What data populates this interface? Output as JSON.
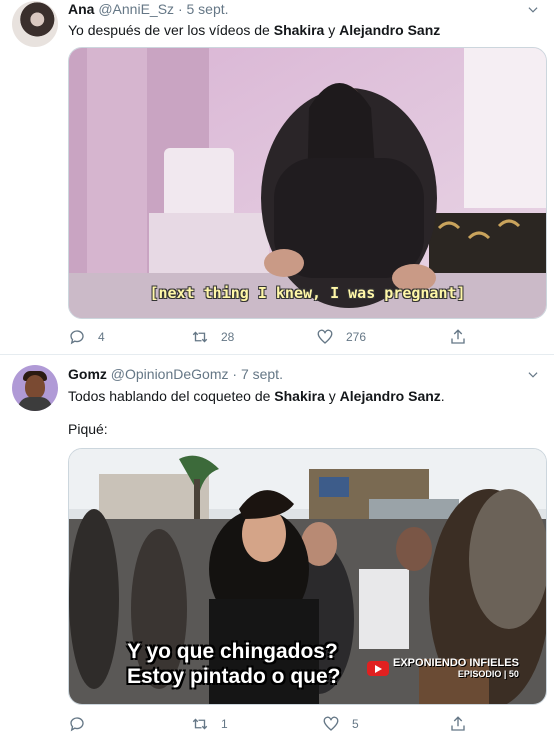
{
  "tweets": [
    {
      "name": "Ana",
      "handle": "@AnniE_Sz",
      "sep": "·",
      "date": "5 sept.",
      "text": {
        "p1": "Yo después de ver los vídeos de ",
        "b1": "Shakira",
        "p2": " y ",
        "b2": "Alejandro Sanz"
      },
      "media": {
        "caption": "[next thing I knew, I was pregnant]"
      },
      "stats": {
        "replies": "4",
        "retweets": "28",
        "likes": "276"
      }
    },
    {
      "name": "Gomz",
      "handle": "@OpinionDeGomz",
      "sep": "·",
      "date": "7 sept.",
      "text": {
        "p1": "Todos hablando del coqueteo de ",
        "b1": "Shakira",
        "p2": " y ",
        "b2": "Alejandro Sanz",
        "p3": "."
      },
      "text2": "Piqué:",
      "media": {
        "caption1": "Y yo que chingados?",
        "caption2": "Estoy pintado o que?",
        "watermark1": "EXPONIENDO INFIELES",
        "watermark2": "EPISODIO | 50"
      },
      "stats": {
        "replies": "",
        "retweets": "1",
        "likes": "5"
      }
    }
  ],
  "icons": [
    "reply-icon",
    "retweet-icon",
    "like-icon",
    "share-icon",
    "caret-down-icon"
  ],
  "colors": {
    "meta": "#657786",
    "border": "#e6ecf0",
    "text": "#14171a"
  }
}
